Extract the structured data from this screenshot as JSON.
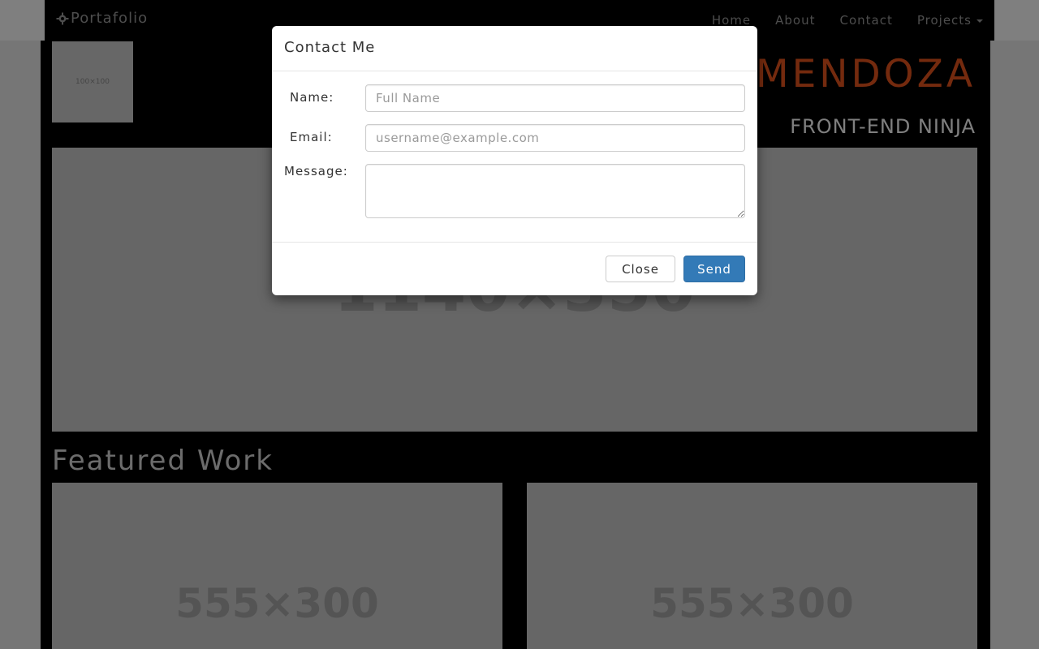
{
  "navbar": {
    "brand": "Portafolio",
    "links": [
      "Home",
      "About",
      "Contact",
      "Projects"
    ]
  },
  "header": {
    "thumbnail_label": "100×100",
    "name": "MENDOZA",
    "subtitle": "FRONT-END NINJA"
  },
  "hero": {
    "placeholder_label": "1140×350"
  },
  "featured": {
    "heading": "Featured Work",
    "cards": [
      {
        "label": "555×300"
      },
      {
        "label": "555×300"
      }
    ]
  },
  "modal": {
    "title": "Contact Me",
    "fields": {
      "name_label": "Name:",
      "name_placeholder": "Full Name",
      "email_label": "Email:",
      "email_placeholder": "username@example.com",
      "message_label": "Message:"
    },
    "buttons": {
      "close": "Close",
      "send": "Send"
    }
  },
  "colors": {
    "accent_orange": "#e8541d",
    "primary_blue": "#337ab7"
  }
}
